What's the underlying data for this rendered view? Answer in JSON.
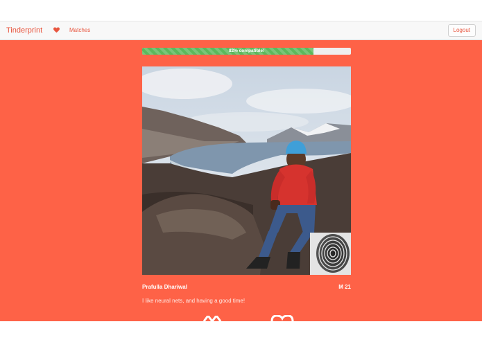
{
  "navbar": {
    "brand": "Tinderprint",
    "matches_label": "Matches",
    "logout_label": "Logout"
  },
  "compatibility": {
    "percent": 82,
    "label": "82% compatible!"
  },
  "profile": {
    "name": "Prafulla Dhariwal",
    "gender_age": "M 21",
    "bio": "I like neural nets, and having a good time!"
  },
  "colors": {
    "accent": "#fe6247",
    "brand_text": "#e8563f",
    "progress_fill": "#5cb85c"
  },
  "icons": {
    "nav_heart": "heart-icon",
    "fingerprint": "fingerprint-icon",
    "reject": "x-icon",
    "like": "heart-icon"
  }
}
